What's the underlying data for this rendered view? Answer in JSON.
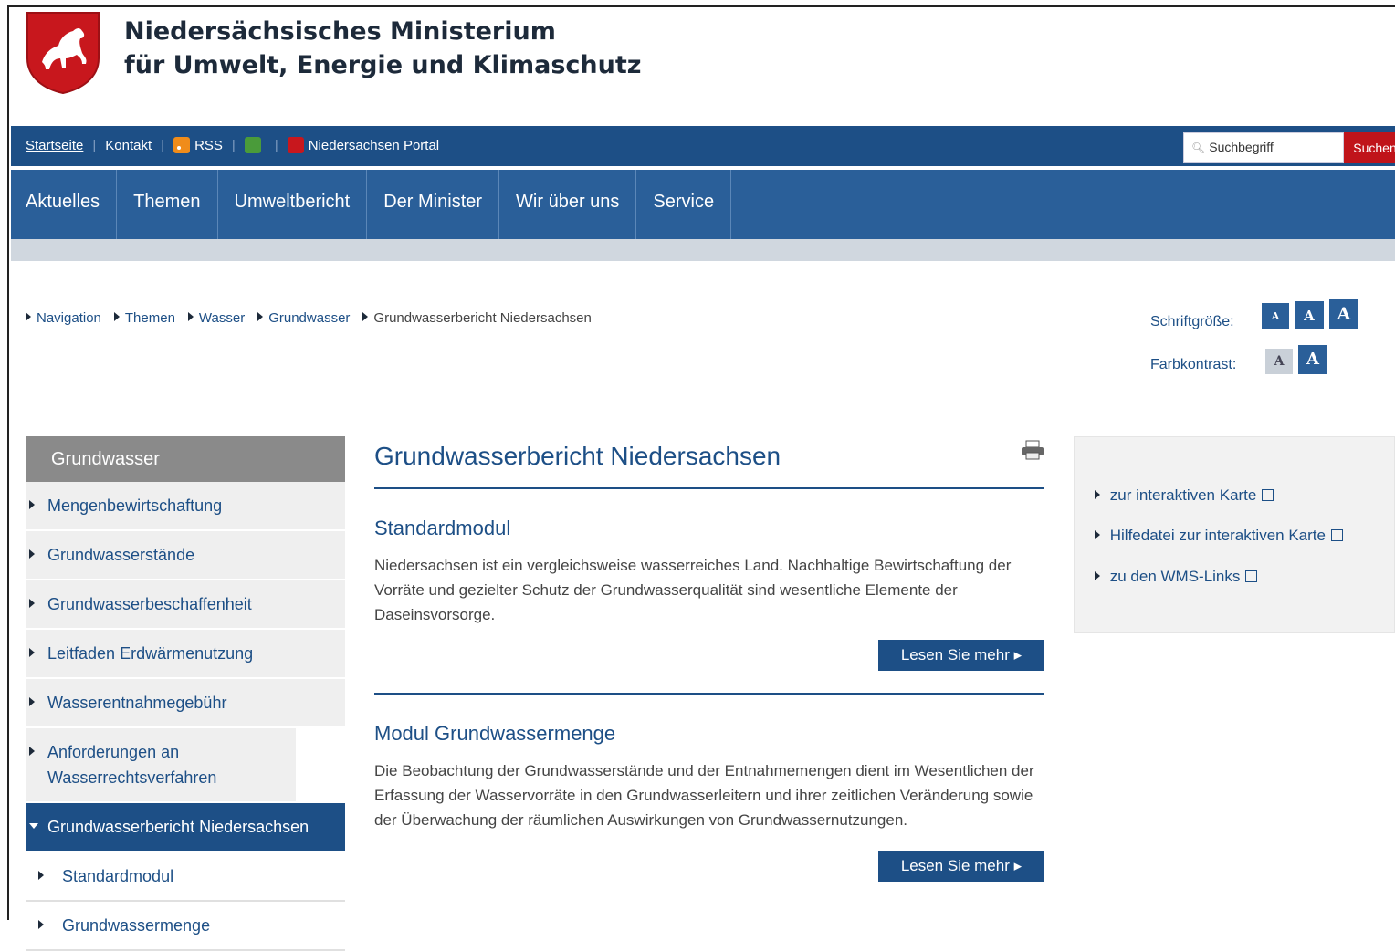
{
  "header": {
    "ministry_line1": "Niedersächsisches Ministerium",
    "ministry_line2": "für Umwelt, Energie und Klimaschutz"
  },
  "topbar": {
    "links": {
      "home": "Startseite",
      "contact": "Kontakt",
      "rss": "RSS",
      "portal": "Niedersachsen Portal"
    },
    "search_placeholder": "Suchbegriff",
    "search_button": "Suchen"
  },
  "mainnav": [
    "Aktuelles",
    "Themen",
    "Umweltbericht",
    "Der Minister",
    "Wir über uns",
    "Service"
  ],
  "breadcrumb": [
    "Navigation",
    "Themen",
    "Wasser",
    "Grundwasser",
    "Grundwasserbericht Niedersachsen"
  ],
  "accessibility": {
    "font_size_label": "Schriftgröße:",
    "contrast_label": "Farbkontrast:",
    "button_letter": "A"
  },
  "sidebar": {
    "title": "Grundwasser",
    "items": [
      "Mengenbewirtschaftung",
      "Grundwasserstände",
      "Grundwasserbeschaffenheit",
      "Leitfaden Erdwärmenutzung",
      "Wasserentnahmegebühr",
      "Anforderungen an Wasserrechtsverfahren",
      "Grundwasserbericht Niedersachsen"
    ],
    "subitems": [
      "Standardmodul",
      "Grundwassermenge"
    ]
  },
  "content": {
    "title": "Grundwasserbericht Niedersachsen",
    "sections": [
      {
        "heading": "Standardmodul",
        "text": "Niedersachsen ist ein vergleichsweise wasserreiches Land. Nachhaltige Bewirtschaftung der Vorräte und gezielter Schutz der Grundwasserqualität sind wesentliche Elemente der Daseinsvorsorge.",
        "button": "Lesen Sie mehr"
      },
      {
        "heading": "Modul Grundwassermenge",
        "text": "Die Beobachtung der Grundwasserstände und der Entnahmemengen dient im Wesentlichen der Erfassung der Wasservorräte in den Grundwasserleitern und ihrer zeitlichen Veränderung sowie der Überwachung der räumlichen Auswirkungen von Grundwassernutzungen.",
        "button": "Lesen Sie mehr"
      }
    ]
  },
  "rightbox": {
    "links": [
      "zur interaktiven Karte",
      "Hilfedatei zur interaktiven Karte",
      "zu den WMS-Links"
    ]
  },
  "colors": {
    "brand_blue": "#1d4f86",
    "nav_blue": "#2a5f99",
    "search_red": "#c0141a"
  }
}
